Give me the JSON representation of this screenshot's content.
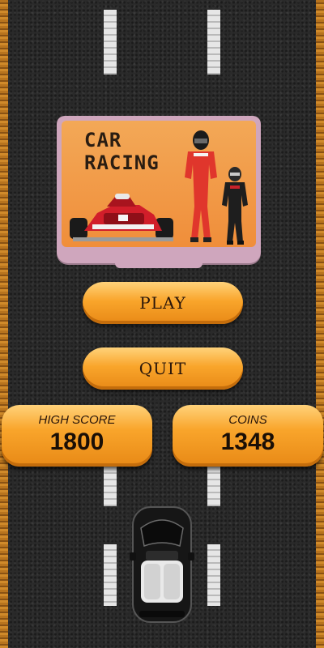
{
  "title": {
    "line1": "CAR",
    "line2": "RACING"
  },
  "buttons": {
    "play": "PLAY",
    "quit": "QUIT"
  },
  "stats": {
    "high_score_label": "HIGH SCORE",
    "high_score_value": "1800",
    "coins_label": "COINS",
    "coins_value": "1348"
  },
  "colors": {
    "button_orange": "#f9a52b",
    "panel_pink": "#cfa6bd",
    "panel_orange": "#f08e3a",
    "asphalt": "#2a2a2a",
    "road_edge": "#b8741e"
  }
}
